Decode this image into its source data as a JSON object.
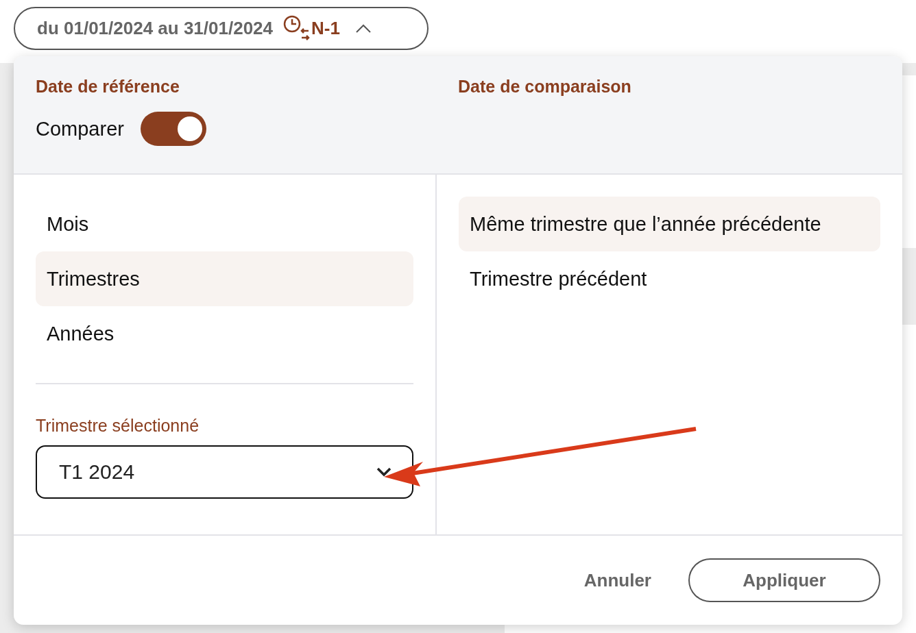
{
  "date_range_button": {
    "label": "du 01/01/2024 au 31/01/2024",
    "compare_badge": "N-1",
    "expanded": true
  },
  "popup": {
    "reference_title": "Date de référence",
    "comparison_title": "Date de comparaison",
    "compare_toggle": {
      "label": "Comparer",
      "on": true
    },
    "period_types": [
      {
        "label": "Mois",
        "selected": false
      },
      {
        "label": "Trimestres",
        "selected": true
      },
      {
        "label": "Années",
        "selected": false
      }
    ],
    "select": {
      "label": "Trimestre sélectionné",
      "value": "T1 2024"
    },
    "comparison_options": [
      {
        "label": "Même trimestre que l’année précédente",
        "selected": true
      },
      {
        "label": "Trimestre précédent",
        "selected": false
      }
    ],
    "buttons": {
      "cancel": "Annuler",
      "apply": "Appliquer"
    }
  }
}
